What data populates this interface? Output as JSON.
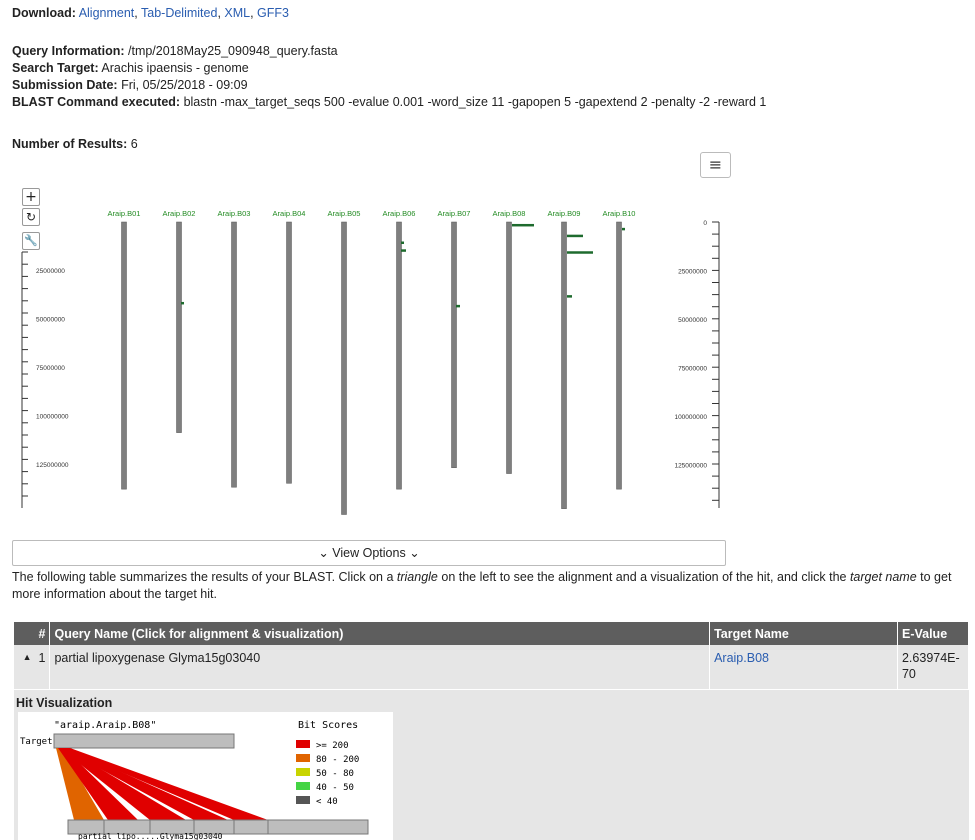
{
  "download": {
    "label": "Download:",
    "links": [
      "Alignment",
      "Tab-Delimited",
      "XML",
      "GFF3"
    ]
  },
  "query_info": {
    "query_label": "Query Information:",
    "query_value": "/tmp/2018May25_090948_query.fasta",
    "target_label": "Search Target:",
    "target_value": "Arachis ipaensis - genome",
    "date_label": "Submission Date:",
    "date_value": "Fri, 05/25/2018 - 09:09",
    "cmd_label": "BLAST Command executed:",
    "cmd_value": "blastn -max_target_seqs 500 -evalue 0.001 -word_size 11 -gapopen 5 -gapextend 2 -penalty -2 -reward 1"
  },
  "results_count": {
    "label": "Number of Results:",
    "value": "6"
  },
  "toolbar": {
    "zoom_in": "+",
    "reset": "↻",
    "settings": "🔧",
    "menu": "≡"
  },
  "karyotype": {
    "chromosomes": [
      "Araip.B01",
      "Araip.B02",
      "Araip.B03",
      "Araip.B04",
      "Araip.B05",
      "Araip.B06",
      "Araip.B07",
      "Araip.B08",
      "Araip.B09",
      "Araip.B10"
    ],
    "chrom_lengths": [
      137,
      108,
      136,
      134,
      150,
      137,
      126,
      129,
      147,
      137
    ],
    "axis_labels_left": [
      "25000000",
      "50000000",
      "75000000",
      "100000000",
      "125000000"
    ],
    "axis_labels_right": [
      "0",
      "25000000",
      "50000000",
      "75000000",
      "100000000",
      "125000000"
    ],
    "hits": [
      {
        "chrom": 1,
        "start": 81,
        "len": 1,
        "offset": 1
      },
      {
        "chrom": 5,
        "start": 13,
        "len": 1,
        "offset": 1
      },
      {
        "chrom": 5,
        "start": 17,
        "len": 1,
        "offset": 1
      },
      {
        "chrom": 6,
        "start": 85,
        "len": 1,
        "offset": 1
      },
      {
        "chrom": 7,
        "start": 2,
        "len": 1,
        "offset": 1
      },
      {
        "chrom": 8,
        "start": 9,
        "len": 1,
        "offset": 1
      },
      {
        "chrom": 8,
        "start": 18,
        "len": 1,
        "offset": 1
      },
      {
        "chrom": 8,
        "start": 41,
        "len": 1,
        "offset": 1
      },
      {
        "chrom": 9,
        "start": 5,
        "len": 1,
        "offset": 1
      }
    ],
    "label_color": "#228b22",
    "hit_color": "#1e6b2e",
    "chrom_color": "#7f7f7f"
  },
  "view_options": {
    "label": "View Options",
    "chevron": "⌄"
  },
  "summary": {
    "text_1": "The following table summarizes the results of your BLAST. Click on a ",
    "em_1": "triangle",
    "text_2": " on the left to see the alignment and a visualization of the hit, and click the ",
    "em_2": "target name",
    "text_3": " to get more information about the target hit."
  },
  "table": {
    "headers": [
      "#",
      "Query Name (Click for alignment & visualization)",
      "Target Name",
      "E-Value"
    ],
    "rows": [
      {
        "index": "1",
        "query": "partial lipoxygenase Glyma15g03040",
        "target": "Araip.B08",
        "evalue": "2.63974E-70"
      }
    ]
  },
  "hit_visualization": {
    "title": "Hit Visualization",
    "target_name": "\"araip.Araip.B08\"",
    "target_label": "Target",
    "legend_title": "Bit Scores",
    "legend": [
      {
        "label": ">= 200",
        "color": "#e00000"
      },
      {
        "label": "80 - 200",
        "color": "#e06400"
      },
      {
        "label": "50 - 80",
        "color": "#c8d400"
      },
      {
        "label": "40 - 50",
        "color": "#44d444"
      },
      {
        "label": "< 40",
        "color": "#555555"
      }
    ],
    "bottom_label": "partial_lipo.....Glyma15g03040"
  }
}
